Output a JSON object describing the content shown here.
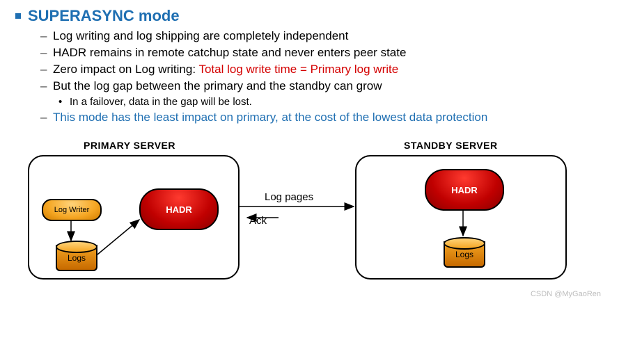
{
  "title": "SUPERASYNC mode",
  "bullets": [
    {
      "text": "Log writing and log shipping are completely independent"
    },
    {
      "text": "HADR remains in remote catchup state and never enters peer state"
    },
    {
      "prefix": "Zero impact on Log writing:  ",
      "red": "Total log write time = Primary log write"
    },
    {
      "text": "But the log gap between the primary and the standby can grow"
    }
  ],
  "sub_bullet": "In a failover, data in the gap will be lost.",
  "last_bullet": "This mode has the least impact on primary, at the cost of the lowest data protection",
  "diagram": {
    "primary_label": "PRIMARY SERVER",
    "standby_label": "STANDBY SERVER",
    "hadr_label": "HADR",
    "logwriter_label": "Log Writer",
    "logs_label": "Logs",
    "logpages_label": "Log pages",
    "ack_label": "Ack"
  },
  "watermark": "CSDN @MyGaoRen"
}
